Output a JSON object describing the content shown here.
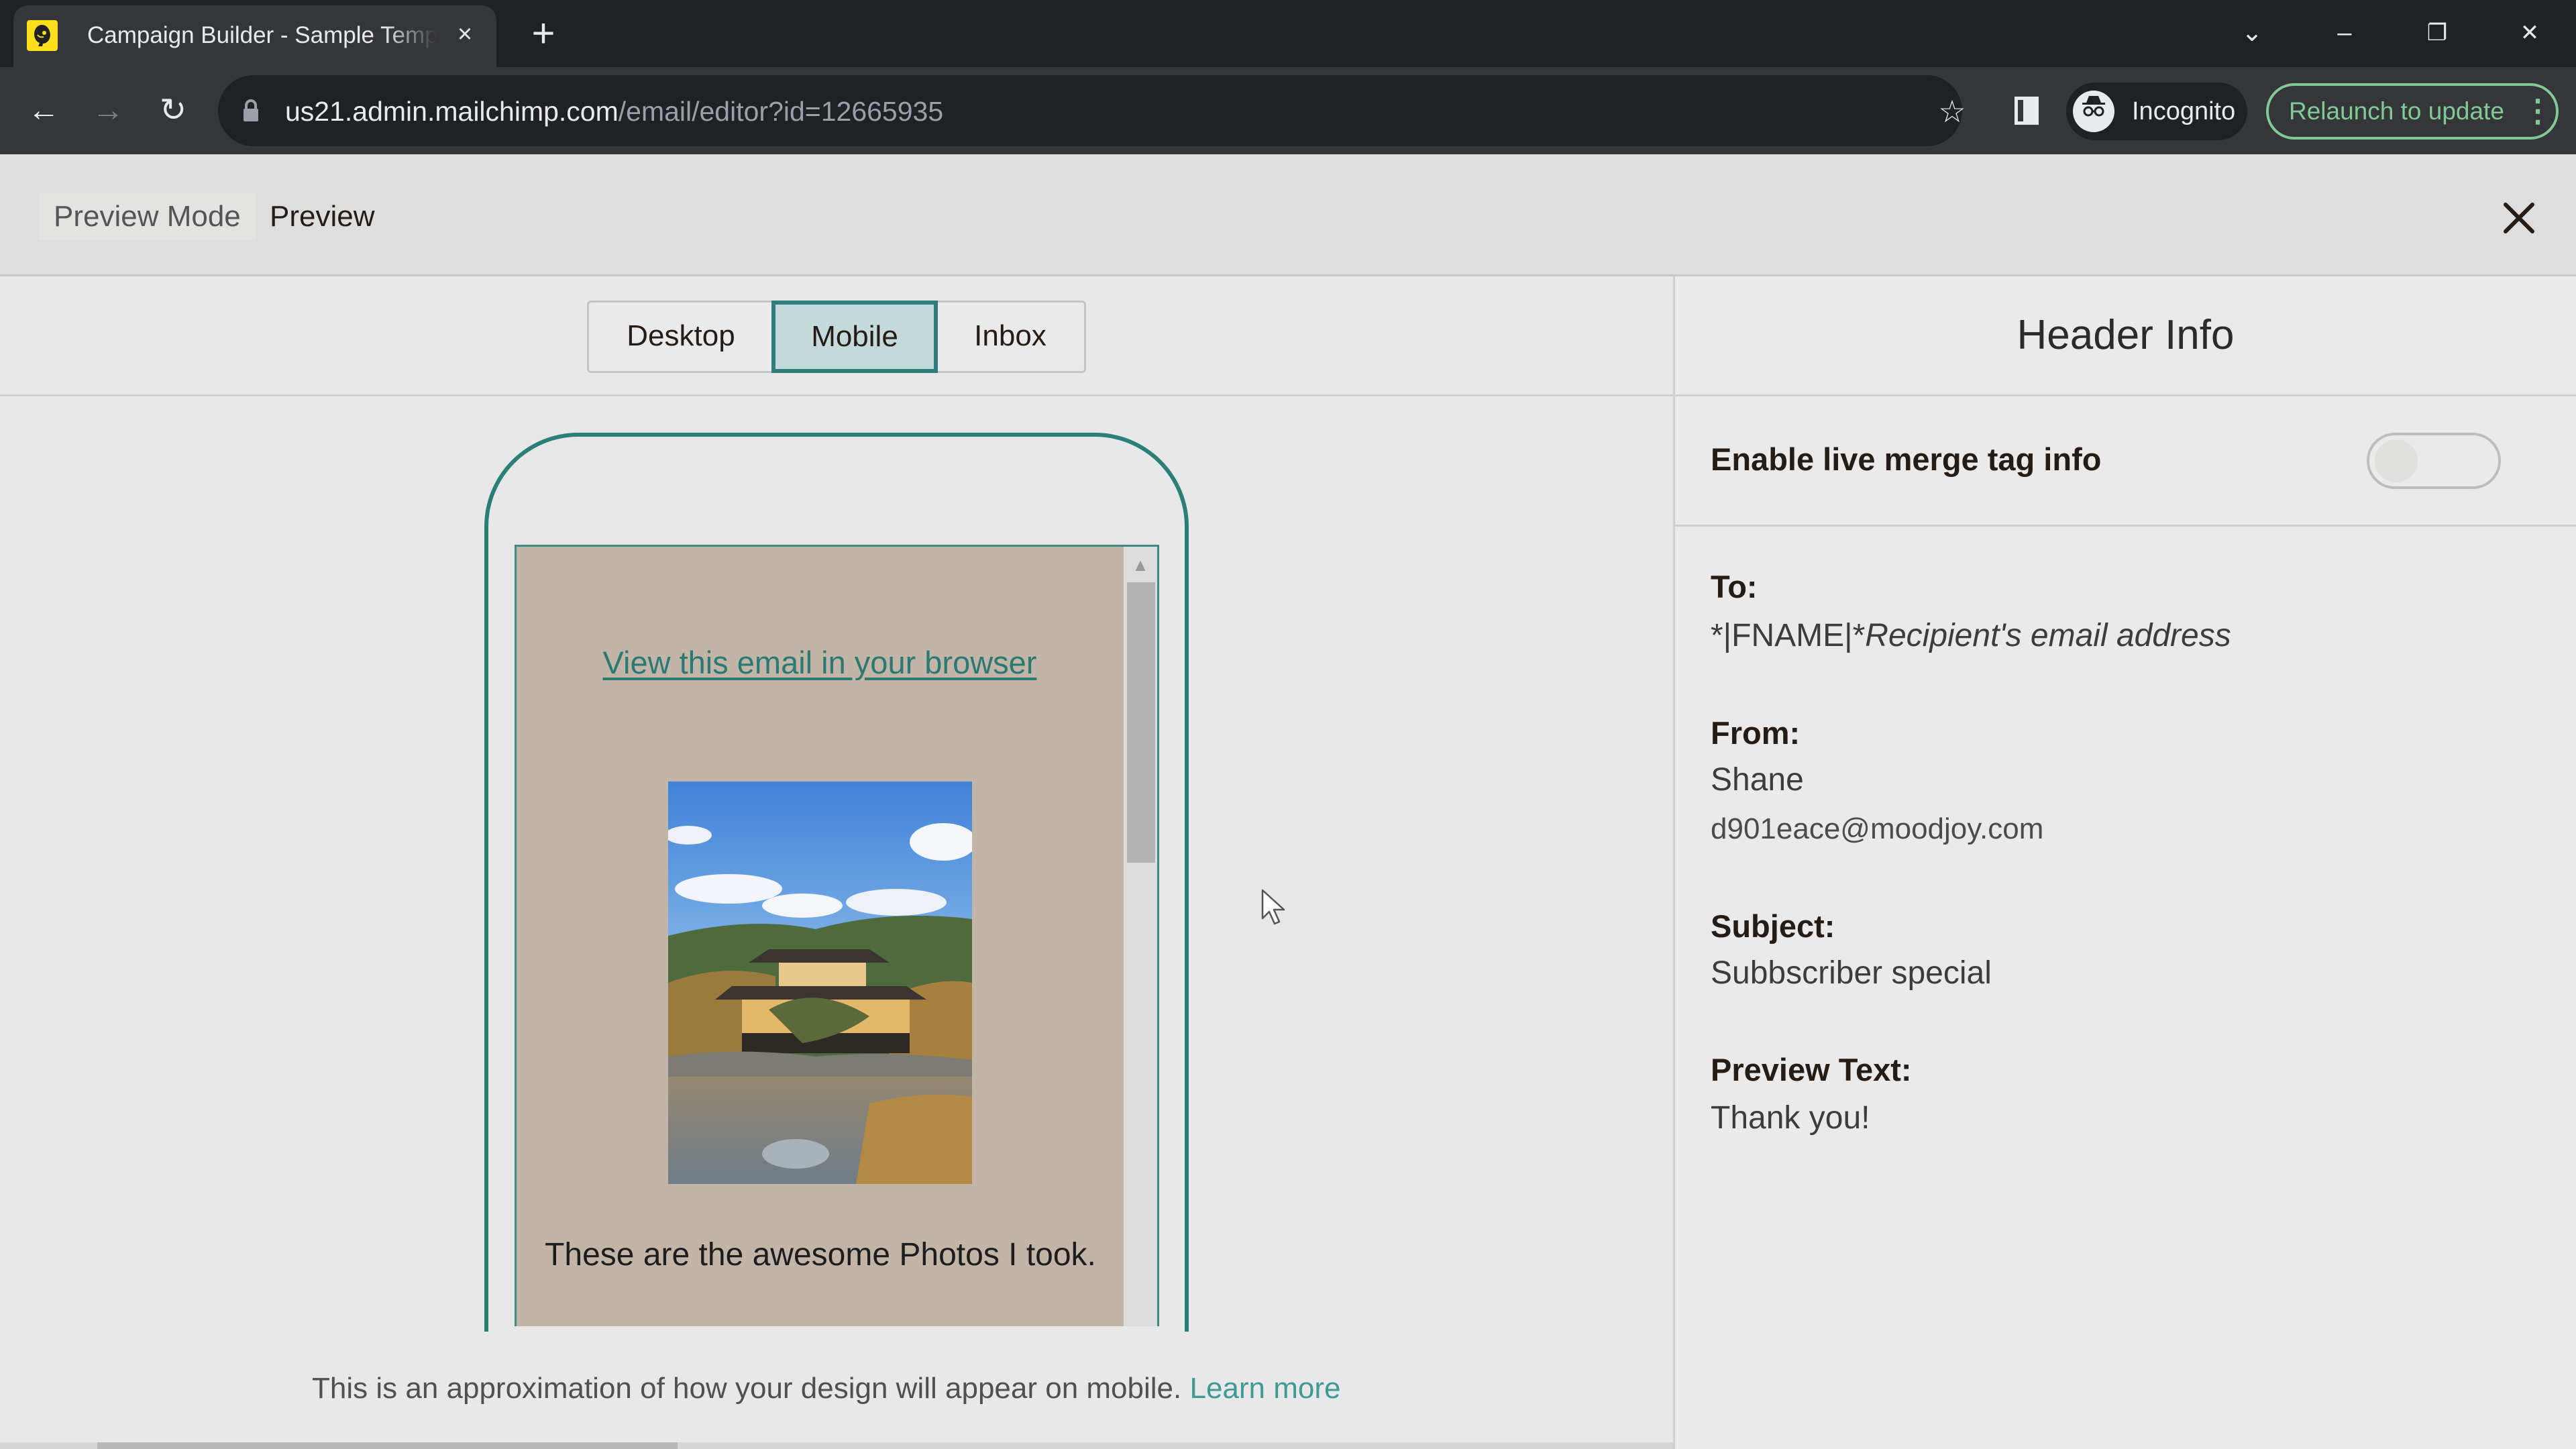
{
  "browser": {
    "tab_title": "Campaign Builder - Sample Template",
    "tab_close_icon": "×",
    "new_tab_icon": "+",
    "url_host": "us21.admin.mailchimp.com",
    "url_path": "/email/editor?id=12665935",
    "incognito_label": "Incognito",
    "relaunch_label": "Relaunch to update",
    "icons": {
      "back": "←",
      "forward": "→",
      "reload": "↻",
      "star": "☆",
      "tab_search": "⌄",
      "minimize": "–",
      "restore": "❐",
      "close": "✕",
      "menu": "⋮",
      "incognito": "🕶"
    }
  },
  "preview_header": {
    "breadcrumb_mode": "Preview Mode",
    "breadcrumb_current": "Preview"
  },
  "view_tabs": [
    {
      "label": "Desktop",
      "active": false
    },
    {
      "label": "Mobile",
      "active": true
    },
    {
      "label": "Inbox",
      "active": false
    }
  ],
  "email_preview": {
    "view_in_browser_link": "View this email in your browser",
    "image_alt": "Golden pavilion temple by a pond under a blue sky",
    "body_text": "These are the awesome Photos I took.",
    "scroll_up_icon": "▲"
  },
  "footer": {
    "note": "This is an approximation of how your design will appear on mobile.",
    "learn_more": "Learn more"
  },
  "header_info": {
    "title": "Header Info",
    "merge_toggle_label": "Enable live merge tag info",
    "merge_toggle_on": false,
    "to_label": "To:",
    "to_merge_tag": "*|FNAME|*",
    "to_value": "Recipient's email address",
    "from_label": "From:",
    "from_name": "Shane",
    "from_email": "d901eace@moodjoy.com",
    "subject_label": "Subject:",
    "subject_value": "Subbscriber special",
    "preview_text_label": "Preview Text:",
    "preview_text_value": "Thank you!"
  },
  "colors": {
    "accent_teal": "#2a7f78",
    "active_tab_bg": "#c4d9d9",
    "email_bg": "#c2b5a8",
    "mailchimp_yellow": "#ffe01b",
    "relaunch_green": "#81c995"
  }
}
